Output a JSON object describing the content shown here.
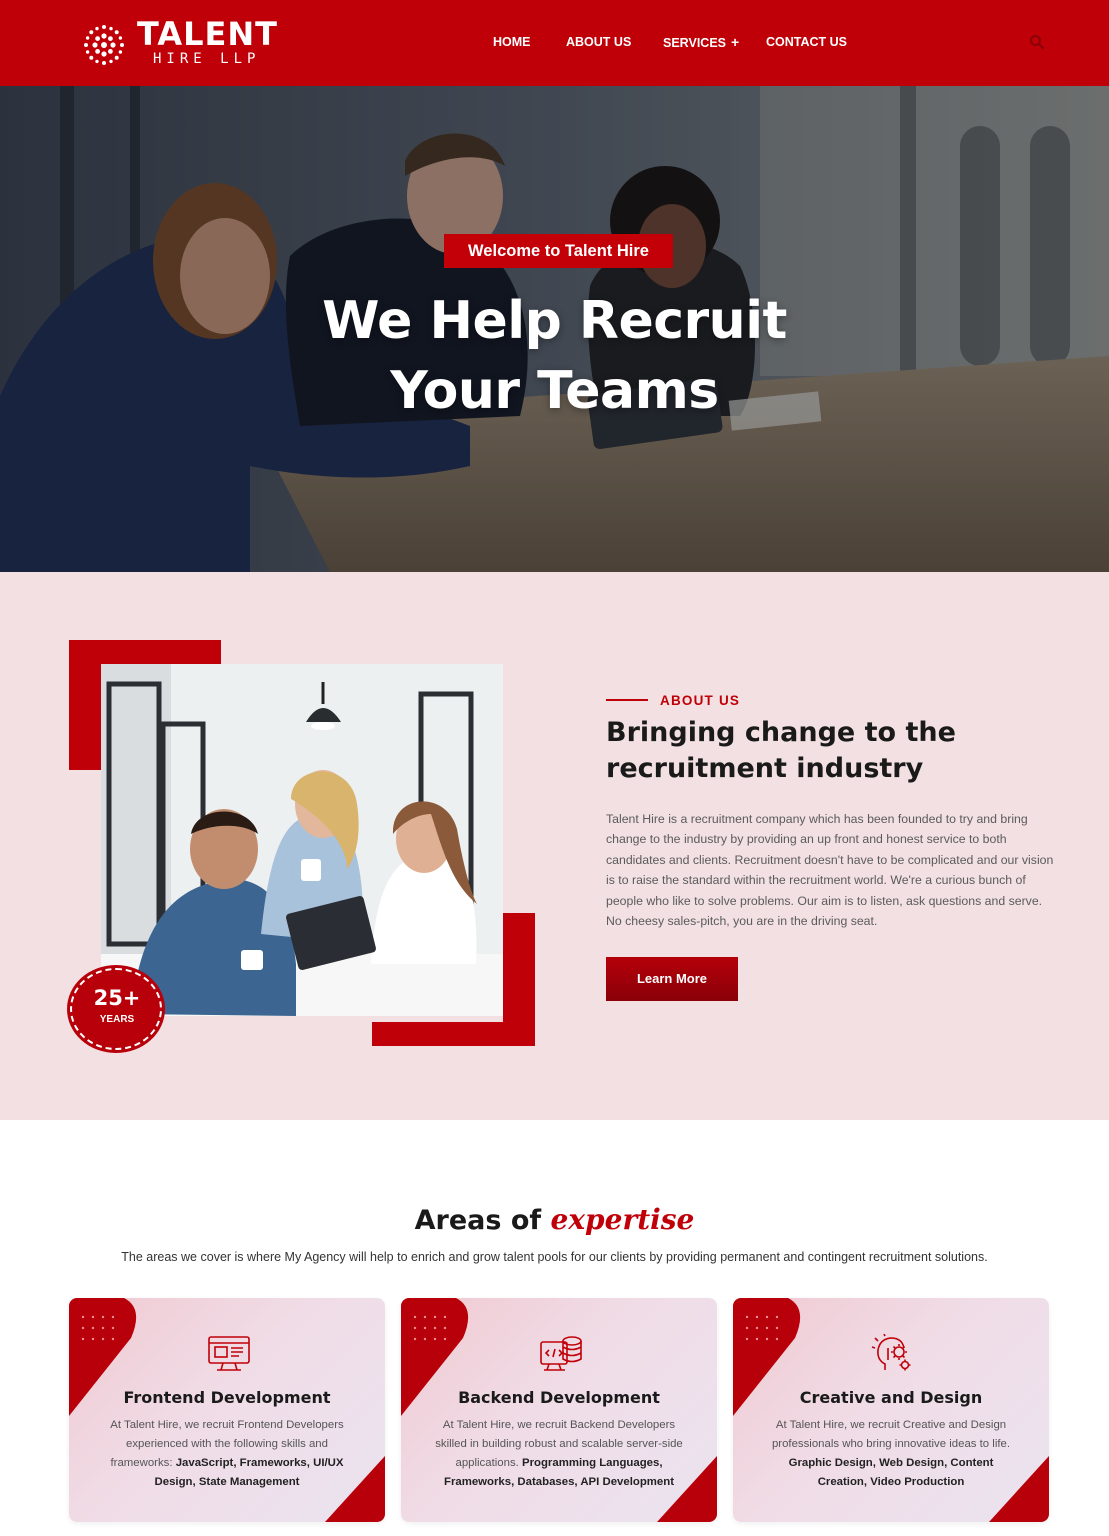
{
  "brand": {
    "name_main": "TALENT",
    "name_sub": "HIRE LLP",
    "primary_color": "#c00008"
  },
  "nav": {
    "items": [
      {
        "label": "HOME"
      },
      {
        "label": "ABOUT US"
      },
      {
        "label": "SERVICES",
        "has_submenu": true,
        "submenu_icon": "+"
      },
      {
        "label": "CONTACT US"
      }
    ],
    "search_icon": "search-icon"
  },
  "hero": {
    "badge": "Welcome to Talent Hire",
    "title_line1": "We Help Recruit",
    "title_line2": "Your Teams"
  },
  "about": {
    "years_value": "25+",
    "years_label": "YEARS",
    "eyebrow": "ABOUT US",
    "title": "Bringing change to the recruitment industry",
    "body": "Talent Hire is a recruitment company which has been founded to try and bring change to the industry by providing an up front and honest service to both candidates and clients. Recruitment doesn't have to be complicated and our vision is to raise the standard within the recruitment world. We're a curious bunch of people who like to solve problems. Our aim is to listen, ask questions and serve. No cheesy sales-pitch, you are in the driving seat.",
    "button_label": "Learn More"
  },
  "expertise": {
    "title_plain": "Areas of",
    "title_accent": "expertise",
    "subtitle": "The areas we cover is where My Agency will help to enrich and grow talent pools for our clients by providing permanent and contingent recruitment solutions.",
    "cards": [
      {
        "icon": "monitor-code-icon",
        "title": "Frontend Development",
        "intro": "At Talent Hire, we recruit Frontend Developers experienced with the following skills and frameworks:",
        "skills": "JavaScript, Frameworks, UI/UX Design, State Management"
      },
      {
        "icon": "server-code-icon",
        "title": "Backend Development",
        "intro": "At Talent Hire, we recruit Backend Developers skilled in building robust and scalable server-side applications.",
        "skills": "Programming Languages, Frameworks, Databases, API Development"
      },
      {
        "icon": "creative-head-gear-icon",
        "title": "Creative and Design",
        "intro": "At Talent Hire, we recruit Creative and Design professionals who bring innovative ideas to life.",
        "skills": "Graphic Design, Web Design, Content Creation, Video Production"
      }
    ]
  }
}
